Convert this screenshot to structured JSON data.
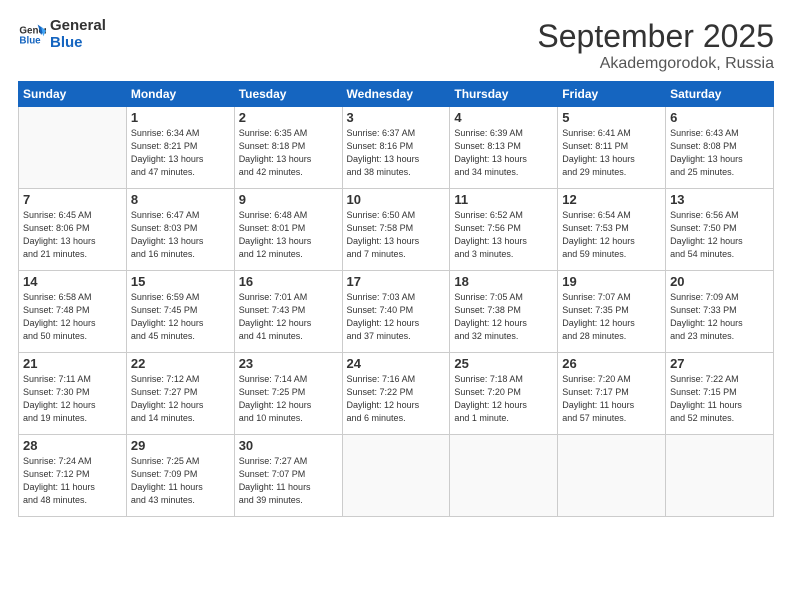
{
  "header": {
    "logo_line1": "General",
    "logo_line2": "Blue",
    "month": "September 2025",
    "location": "Akademgorodok, Russia"
  },
  "days_of_week": [
    "Sunday",
    "Monday",
    "Tuesday",
    "Wednesday",
    "Thursday",
    "Friday",
    "Saturday"
  ],
  "weeks": [
    [
      {
        "day": "",
        "info": ""
      },
      {
        "day": "1",
        "info": "Sunrise: 6:34 AM\nSunset: 8:21 PM\nDaylight: 13 hours\nand 47 minutes."
      },
      {
        "day": "2",
        "info": "Sunrise: 6:35 AM\nSunset: 8:18 PM\nDaylight: 13 hours\nand 42 minutes."
      },
      {
        "day": "3",
        "info": "Sunrise: 6:37 AM\nSunset: 8:16 PM\nDaylight: 13 hours\nand 38 minutes."
      },
      {
        "day": "4",
        "info": "Sunrise: 6:39 AM\nSunset: 8:13 PM\nDaylight: 13 hours\nand 34 minutes."
      },
      {
        "day": "5",
        "info": "Sunrise: 6:41 AM\nSunset: 8:11 PM\nDaylight: 13 hours\nand 29 minutes."
      },
      {
        "day": "6",
        "info": "Sunrise: 6:43 AM\nSunset: 8:08 PM\nDaylight: 13 hours\nand 25 minutes."
      }
    ],
    [
      {
        "day": "7",
        "info": "Sunrise: 6:45 AM\nSunset: 8:06 PM\nDaylight: 13 hours\nand 21 minutes."
      },
      {
        "day": "8",
        "info": "Sunrise: 6:47 AM\nSunset: 8:03 PM\nDaylight: 13 hours\nand 16 minutes."
      },
      {
        "day": "9",
        "info": "Sunrise: 6:48 AM\nSunset: 8:01 PM\nDaylight: 13 hours\nand 12 minutes."
      },
      {
        "day": "10",
        "info": "Sunrise: 6:50 AM\nSunset: 7:58 PM\nDaylight: 13 hours\nand 7 minutes."
      },
      {
        "day": "11",
        "info": "Sunrise: 6:52 AM\nSunset: 7:56 PM\nDaylight: 13 hours\nand 3 minutes."
      },
      {
        "day": "12",
        "info": "Sunrise: 6:54 AM\nSunset: 7:53 PM\nDaylight: 12 hours\nand 59 minutes."
      },
      {
        "day": "13",
        "info": "Sunrise: 6:56 AM\nSunset: 7:50 PM\nDaylight: 12 hours\nand 54 minutes."
      }
    ],
    [
      {
        "day": "14",
        "info": "Sunrise: 6:58 AM\nSunset: 7:48 PM\nDaylight: 12 hours\nand 50 minutes."
      },
      {
        "day": "15",
        "info": "Sunrise: 6:59 AM\nSunset: 7:45 PM\nDaylight: 12 hours\nand 45 minutes."
      },
      {
        "day": "16",
        "info": "Sunrise: 7:01 AM\nSunset: 7:43 PM\nDaylight: 12 hours\nand 41 minutes."
      },
      {
        "day": "17",
        "info": "Sunrise: 7:03 AM\nSunset: 7:40 PM\nDaylight: 12 hours\nand 37 minutes."
      },
      {
        "day": "18",
        "info": "Sunrise: 7:05 AM\nSunset: 7:38 PM\nDaylight: 12 hours\nand 32 minutes."
      },
      {
        "day": "19",
        "info": "Sunrise: 7:07 AM\nSunset: 7:35 PM\nDaylight: 12 hours\nand 28 minutes."
      },
      {
        "day": "20",
        "info": "Sunrise: 7:09 AM\nSunset: 7:33 PM\nDaylight: 12 hours\nand 23 minutes."
      }
    ],
    [
      {
        "day": "21",
        "info": "Sunrise: 7:11 AM\nSunset: 7:30 PM\nDaylight: 12 hours\nand 19 minutes."
      },
      {
        "day": "22",
        "info": "Sunrise: 7:12 AM\nSunset: 7:27 PM\nDaylight: 12 hours\nand 14 minutes."
      },
      {
        "day": "23",
        "info": "Sunrise: 7:14 AM\nSunset: 7:25 PM\nDaylight: 12 hours\nand 10 minutes."
      },
      {
        "day": "24",
        "info": "Sunrise: 7:16 AM\nSunset: 7:22 PM\nDaylight: 12 hours\nand 6 minutes."
      },
      {
        "day": "25",
        "info": "Sunrise: 7:18 AM\nSunset: 7:20 PM\nDaylight: 12 hours\nand 1 minute."
      },
      {
        "day": "26",
        "info": "Sunrise: 7:20 AM\nSunset: 7:17 PM\nDaylight: 11 hours\nand 57 minutes."
      },
      {
        "day": "27",
        "info": "Sunrise: 7:22 AM\nSunset: 7:15 PM\nDaylight: 11 hours\nand 52 minutes."
      }
    ],
    [
      {
        "day": "28",
        "info": "Sunrise: 7:24 AM\nSunset: 7:12 PM\nDaylight: 11 hours\nand 48 minutes."
      },
      {
        "day": "29",
        "info": "Sunrise: 7:25 AM\nSunset: 7:09 PM\nDaylight: 11 hours\nand 43 minutes."
      },
      {
        "day": "30",
        "info": "Sunrise: 7:27 AM\nSunset: 7:07 PM\nDaylight: 11 hours\nand 39 minutes."
      },
      {
        "day": "",
        "info": ""
      },
      {
        "day": "",
        "info": ""
      },
      {
        "day": "",
        "info": ""
      },
      {
        "day": "",
        "info": ""
      }
    ]
  ]
}
